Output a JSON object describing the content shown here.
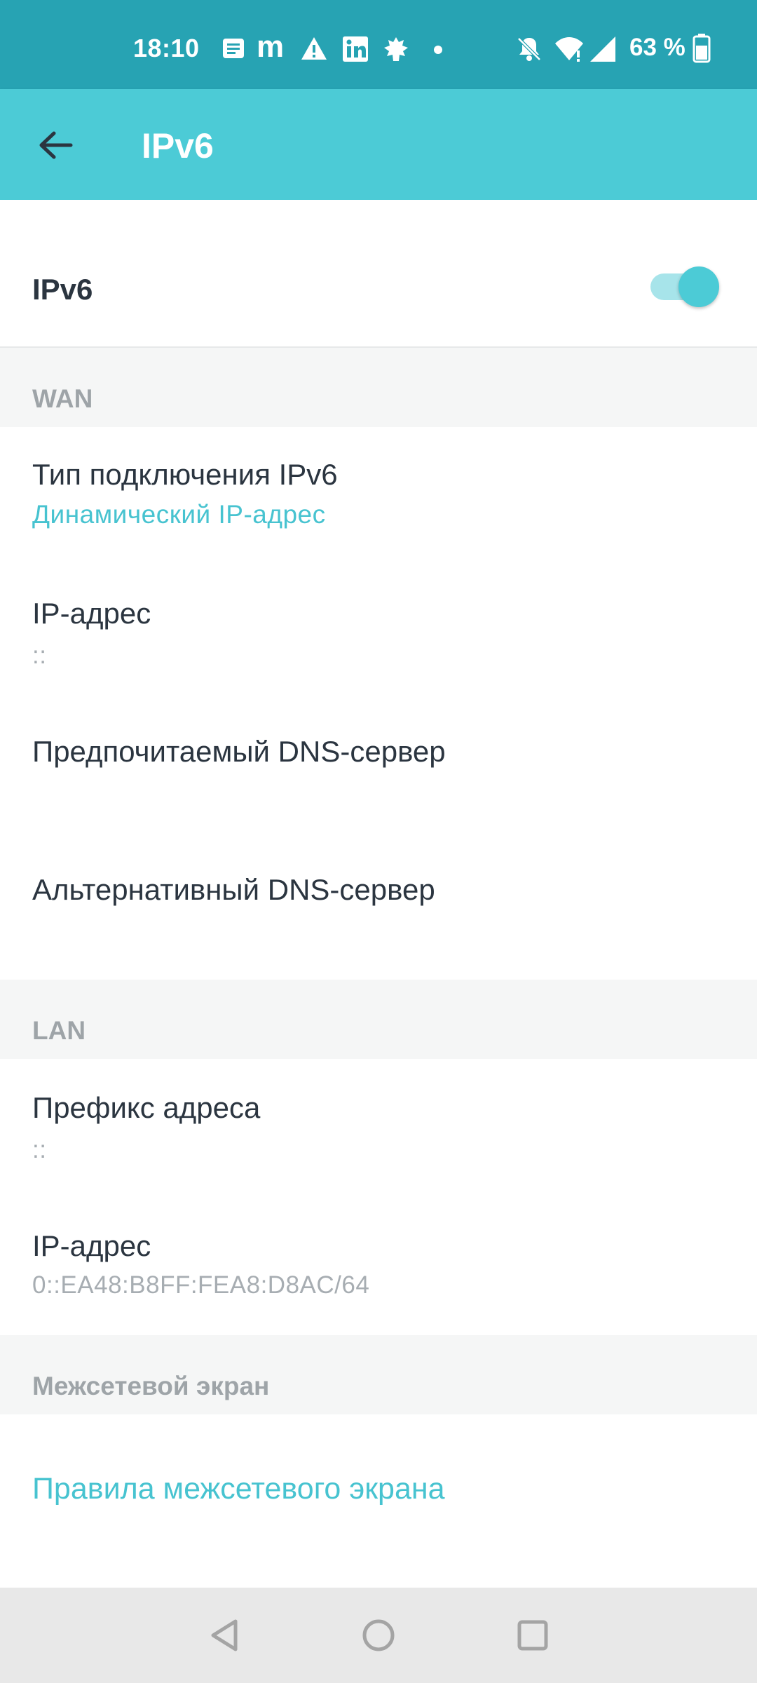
{
  "status_bar": {
    "time": "18:10",
    "battery": "63 %",
    "icons": [
      "notes-icon",
      "m-app-icon",
      "warning-icon",
      "linkedin-icon",
      "leaf-icon",
      "dot-icon",
      "bell-off-icon",
      "wifi-icon",
      "signal-icon",
      "battery-icon"
    ]
  },
  "app_bar": {
    "title": "IPv6",
    "back_icon": "arrow-left-icon"
  },
  "ipv6_toggle": {
    "label": "IPv6",
    "enabled": true
  },
  "wan": {
    "header": "WAN",
    "connection_type": {
      "title": "Тип подключения IPv6",
      "value": "Динамический IP-адрес"
    },
    "ip_address": {
      "title": "IP-адрес",
      "value": "::"
    },
    "preferred_dns": {
      "title": "Предпочитаемый DNS-сервер"
    },
    "alternate_dns": {
      "title": "Альтернативный DNS-сервер"
    }
  },
  "lan": {
    "header": "LAN",
    "prefix": {
      "title": "Префикс адреса",
      "value": "::"
    },
    "ip_address": {
      "title": "IP-адрес",
      "value": "0::EA48:B8FF:FEA8:D8AC/64"
    }
  },
  "firewall": {
    "header": "Межсетевой экран",
    "rules_link": "Правила межсетевого экрана"
  },
  "colors": {
    "status_bar": "#27a3b3",
    "app_bar": "#4ccbd6",
    "accent": "#47c3d0",
    "section_bg": "#f5f6f6",
    "text": "#2b3540",
    "muted": "#a7adb2"
  },
  "nav_bar": {
    "icons": [
      "back-triangle-icon",
      "home-circle-icon",
      "recents-square-icon"
    ]
  }
}
